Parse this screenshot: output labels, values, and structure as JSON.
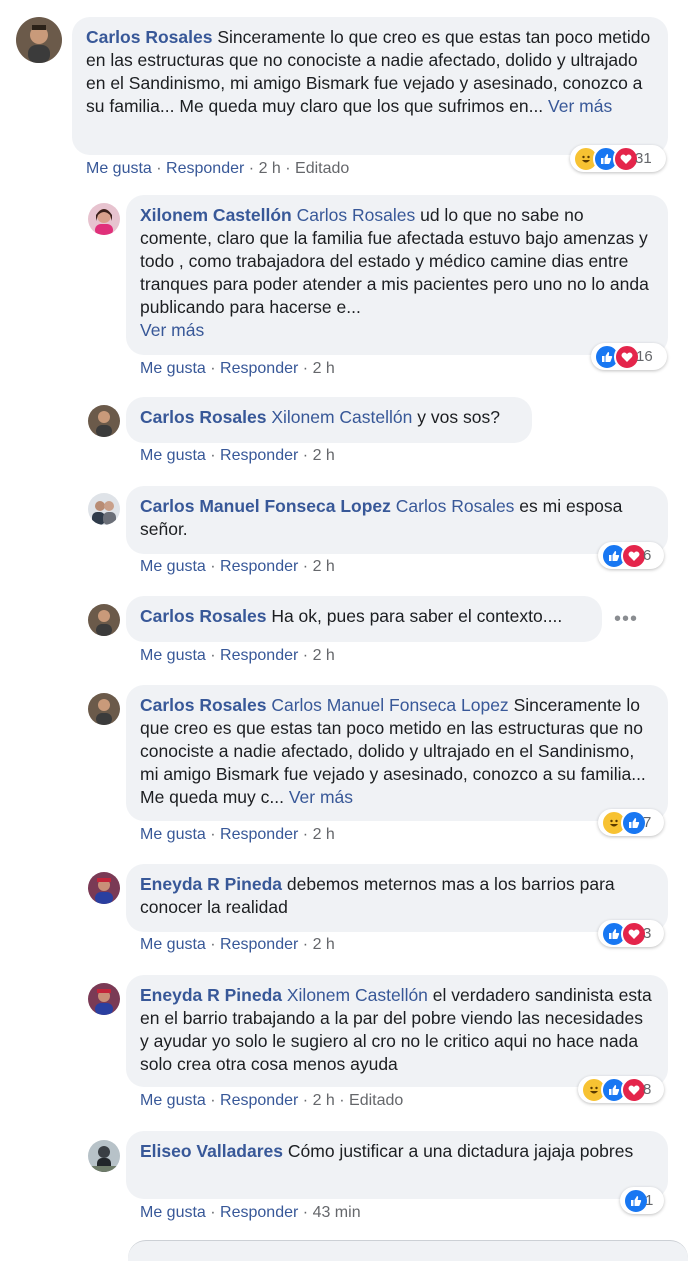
{
  "comments": [
    {
      "author": "Carlos Rosales",
      "mention": "",
      "text": "Sinceramente lo que creo es que estas tan poco metido en las estructuras que no conociste a nadie afectado, dolido y ultrajado en el Sandinismo, mi amigo Bismark fue vejado y asesinado, conozco a su familia... Me queda muy claro que los que sufrimos en...",
      "more": "Ver más",
      "like": "Me gusta",
      "reply": "Responder",
      "time": "2 h",
      "edited": "Editado",
      "reactions": "31",
      "reaction_icons": [
        "haha",
        "like",
        "love"
      ]
    },
    {
      "author": "Xilonem Castellón",
      "mention": "Carlos Rosales",
      "text": "ud lo que no sabe no comente, claro que la familia fue afectada estuvo bajo amenzas y todo , como trabajadora del estado y médico camine dias entre tranques para poder atender a mis pacientes pero uno no lo anda publicando para hacerse e...",
      "more": "Ver más",
      "like": "Me gusta",
      "reply": "Responder",
      "time": "2 h",
      "reactions": "16",
      "reaction_icons": [
        "like",
        "love"
      ]
    },
    {
      "author": "Carlos Rosales",
      "mention": "Xilonem Castellón",
      "text": "y vos sos?",
      "like": "Me gusta",
      "reply": "Responder",
      "time": "2 h"
    },
    {
      "author": "Carlos Manuel Fonseca Lopez",
      "mention": "Carlos Rosales",
      "text": "es mi esposa señor.",
      "like": "Me gusta",
      "reply": "Responder",
      "time": "2 h",
      "reactions": "6",
      "reaction_icons": [
        "like",
        "love"
      ]
    },
    {
      "author": "Carlos Rosales",
      "mention": "",
      "text": "Ha ok, pues para saber el contexto....",
      "like": "Me gusta",
      "reply": "Responder",
      "time": "2 h",
      "options": "•••"
    },
    {
      "author": "Carlos Rosales",
      "mention": "Carlos Manuel Fonseca Lopez",
      "text": "Sinceramente lo que creo es que estas tan poco metido en las estructuras que no conociste a nadie afectado, dolido y ultrajado en el Sandinismo, mi amigo Bismark fue vejado y asesinado, conozco a su familia... Me queda muy c...",
      "more": "Ver más",
      "like": "Me gusta",
      "reply": "Responder",
      "time": "2 h",
      "reactions": "7",
      "reaction_icons": [
        "haha",
        "like"
      ]
    },
    {
      "author": "Eneyda R Pineda",
      "mention": "",
      "text": "debemos meternos mas a los barrios para conocer la realidad",
      "like": "Me gusta",
      "reply": "Responder",
      "time": "2 h",
      "reactions": "3",
      "reaction_icons": [
        "like",
        "love"
      ]
    },
    {
      "author": "Eneyda R Pineda",
      "mention": "Xilonem Castellón",
      "text": "el verdadero sandinista esta en el barrio trabajando a la par del pobre viendo las necesidades y ayudar yo solo le sugiero al cro no le critico aqui no hace nada solo crea otra cosa menos ayuda",
      "like": "Me gusta",
      "reply": "Responder",
      "time": "2 h",
      "edited": "Editado",
      "reactions": "8",
      "reaction_icons": [
        "haha",
        "like",
        "love"
      ]
    },
    {
      "author": "Eliseo Valladares",
      "mention": "",
      "text": "Cómo justificar a una dictadura jajaja pobres",
      "like": "Me gusta",
      "reply": "Responder",
      "time": "43 min",
      "reactions": "1",
      "reaction_icons": [
        "like"
      ]
    }
  ],
  "colors": {
    "link": "#385898",
    "bubble": "#f0f2f5",
    "meta": "#65676b",
    "like_blue": "#1877f2",
    "love_red": "#e4254b",
    "haha_yellow": "#f7c232"
  }
}
